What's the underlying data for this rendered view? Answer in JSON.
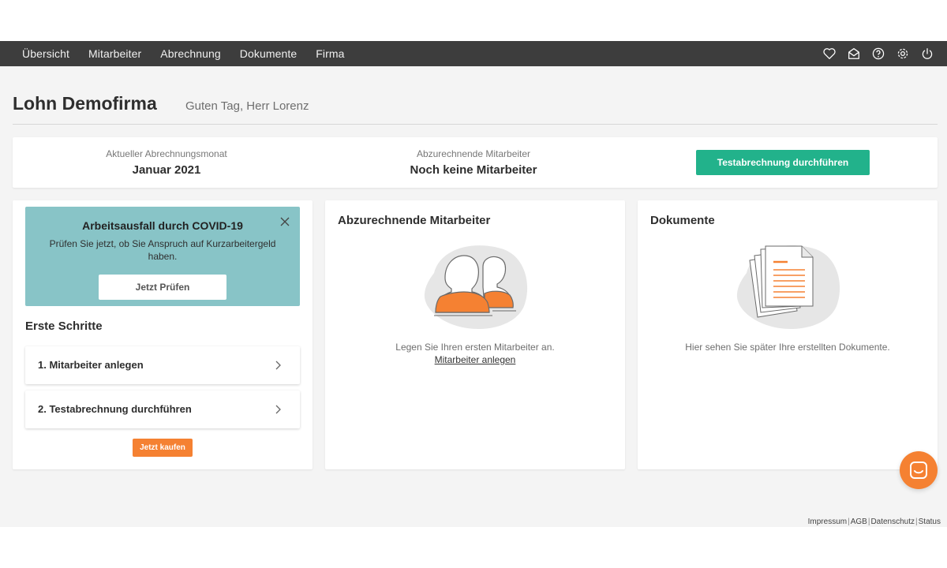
{
  "nav": {
    "items": [
      "Übersicht",
      "Mitarbeiter",
      "Abrechnung",
      "Dokumente",
      "Firma"
    ],
    "icons": [
      "heart-icon",
      "mail-icon",
      "help-icon",
      "settings-icon",
      "power-icon"
    ]
  },
  "header": {
    "company": "Lohn Demofirma",
    "greeting": "Guten Tag, Herr Lorenz"
  },
  "summary": {
    "month_label": "Aktueller Abrechnungsmonat",
    "month_value": "Januar 2021",
    "employees_label": "Abzurechnende Mitarbeiter",
    "employees_value": "Noch keine Mitarbeiter",
    "test_button": "Testabrechnung durchführen"
  },
  "covid": {
    "title": "Arbeitsausfall durch COVID-19",
    "text": "Prüfen Sie jetzt, ob Sie Anspruch auf Kurzarbeitergeld haben.",
    "button": "Jetzt Prüfen"
  },
  "steps": {
    "title": "Erste Schritte",
    "items": [
      "1. Mitarbeiter anlegen",
      "2. Testabrechnung durchführen"
    ],
    "buy_button": "Jetzt kaufen"
  },
  "employees_card": {
    "title": "Abzurechnende Mitarbeiter",
    "empty_text": "Legen Sie Ihren ersten Mitarbeiter an.",
    "link": "Mitarbeiter anlegen"
  },
  "documents_card": {
    "title": "Dokumente",
    "empty_text": "Hier sehen Sie später Ihre erstellten Dokumente."
  },
  "footer": {
    "links": [
      "Impressum",
      "AGB",
      "Datenschutz",
      "Status"
    ]
  },
  "colors": {
    "nav_bg": "#3d3d3d",
    "primary_green": "#22b28b",
    "accent_orange": "#f58132",
    "covid_teal": "#88c4c7",
    "page_bg": "#f4f4f4"
  }
}
